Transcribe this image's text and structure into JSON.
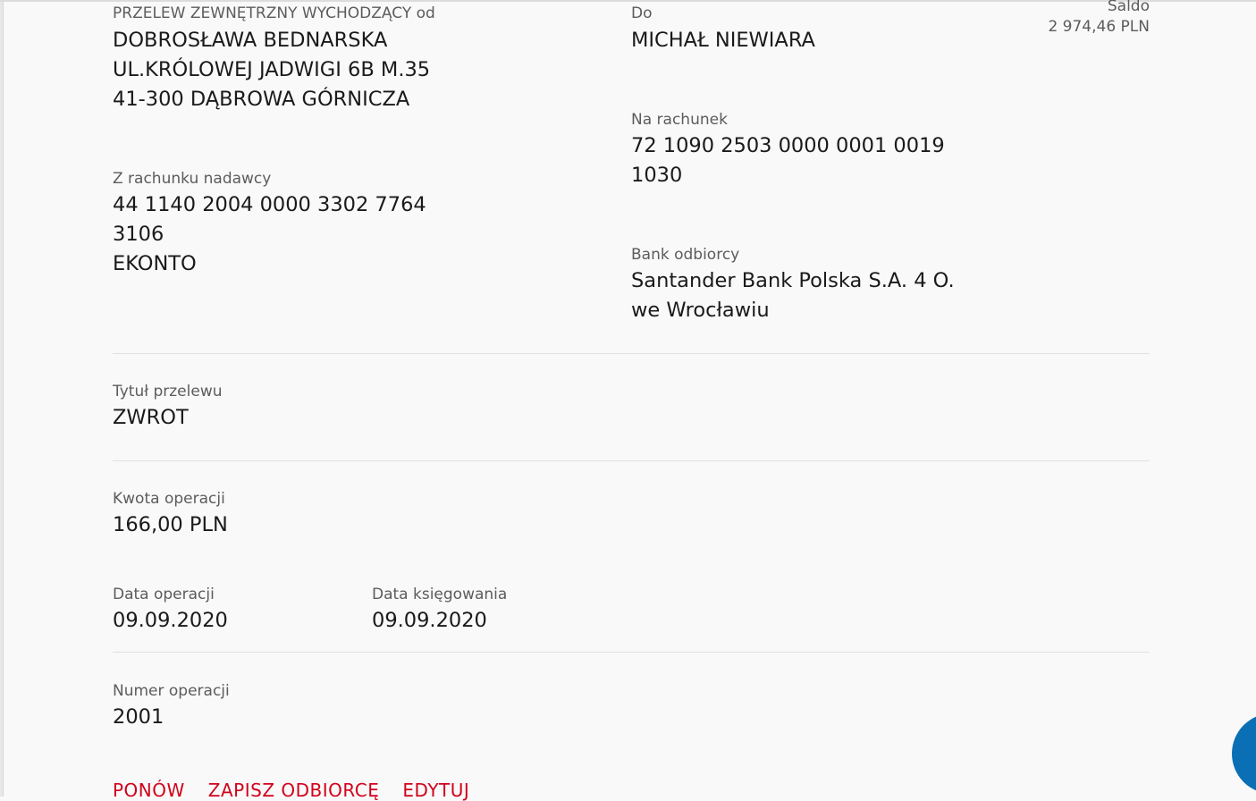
{
  "sender": {
    "heading": "PRZELEW ZEWNĘTRZNY WYCHODZĄCY od",
    "name": "DOBROSŁAWA BEDNARSKA",
    "address_line1": "UL.KRÓLOWEJ JADWIGI 6B M.35",
    "address_line2": "41-300 DĄBROWA GÓRNICZA",
    "account_label": "Z rachunku nadawcy",
    "account_line1": "44 1140 2004 0000 3302 7764",
    "account_line2": "3106",
    "account_name": "EKONTO"
  },
  "recipient": {
    "heading": "Do",
    "name": "MICHAŁ NIEWIARA",
    "account_label": "Na rachunek",
    "account_line1": "72 1090 2503 0000 0001 0019",
    "account_line2": "1030",
    "bank_label": "Bank odbiorcy",
    "bank_line1": "Santander Bank Polska S.A. 4 O.",
    "bank_line2": "we Wrocławiu"
  },
  "balance": {
    "label": "Saldo",
    "value": "2 974,46 PLN"
  },
  "title": {
    "label": "Tytuł przelewu",
    "value": "ZWROT"
  },
  "amount": {
    "label": "Kwota operacji",
    "value": "166,00 PLN"
  },
  "dates": {
    "operation_label": "Data operacji",
    "operation_value": "09.09.2020",
    "booking_label": "Data księgowania",
    "booking_value": "09.09.2020"
  },
  "operation_number": {
    "label": "Numer operacji",
    "value": "2001"
  },
  "actions": {
    "repeat": "PONÓW",
    "save_recipient": "ZAPISZ ODBIORCĘ",
    "edit": "EDYTUJ"
  },
  "colors": {
    "accent": "#d0021b",
    "fab": "#0a6fb5"
  },
  "icons": {
    "fab": "help-chat-icon"
  }
}
